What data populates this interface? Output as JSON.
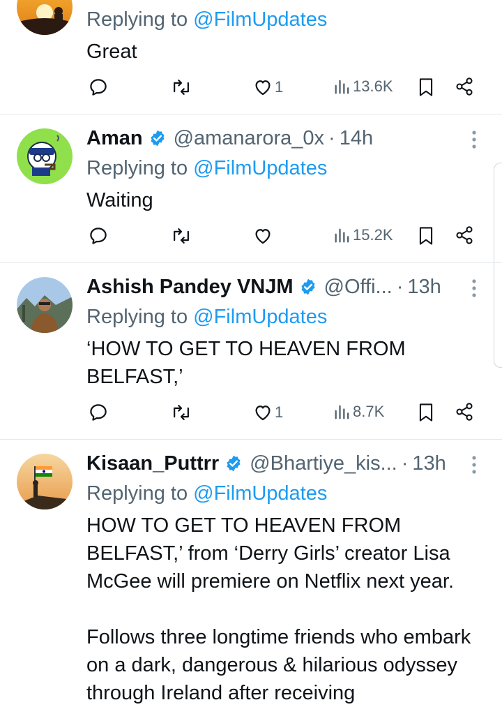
{
  "colors": {
    "accent": "#1d9bf0",
    "muted": "#536471",
    "verified": "#1d9bf0"
  },
  "tweets": [
    {
      "reply_prefix": "Replying to ",
      "reply_to": "@FilmUpdates",
      "text": "Great",
      "actions": {
        "replies": "",
        "retweets": "",
        "likes": "1",
        "views": "13.6K"
      }
    },
    {
      "name": "Aman",
      "handle": "@amanarora_0x",
      "separator": "·",
      "time": "14h",
      "reply_prefix": "Replying to ",
      "reply_to": "@FilmUpdates",
      "text": "Waiting",
      "actions": {
        "replies": "",
        "retweets": "",
        "likes": "",
        "views": "15.2K"
      }
    },
    {
      "name": "Ashish Pandey VNJM",
      "handle": "@Offi...",
      "separator": "·",
      "time": "13h",
      "reply_prefix": "Replying to ",
      "reply_to": "@FilmUpdates",
      "text": "‘HOW TO GET TO HEAVEN FROM BELFAST,’",
      "actions": {
        "replies": "",
        "retweets": "",
        "likes": "1",
        "views": "8.7K"
      }
    },
    {
      "name": "Kisaan_Puttrr",
      "handle": "@Bhartiye_kis...",
      "separator": "·",
      "time": "13h",
      "reply_prefix": "Replying to ",
      "reply_to": "@FilmUpdates",
      "text": "HOW TO GET TO HEAVEN FROM BELFAST,’ from ‘Derry Girls’ creator Lisa McGee will premiere on Netflix next year.\n\nFollows three longtime friends who embark on a dark, dangerous & hilarious odyssey through Ireland after receiving"
    }
  ]
}
